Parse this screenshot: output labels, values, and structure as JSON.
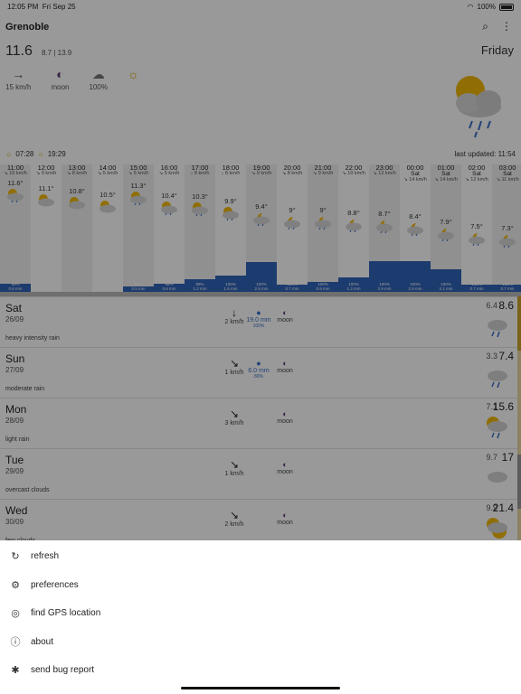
{
  "status_bar": {
    "time": "12:05 PM",
    "date": "Fri Sep 25",
    "battery": "100%"
  },
  "header": {
    "location": "Grenoble",
    "day": "Friday",
    "search_icon": "search-icon",
    "more_icon": "more-vert-icon"
  },
  "current": {
    "temp": "11.6",
    "temp_min": "8.7",
    "temp_sep": "|",
    "temp_max": "13.9",
    "wind_arrow": "→",
    "wind": "15 km/h",
    "moon": "moon",
    "clouds": "100%"
  },
  "sun": {
    "rise": "07:28",
    "set": "19:29"
  },
  "last_updated": "last updated: 11:54",
  "hourly": [
    {
      "time": "11:00",
      "wind": "↘ 15 km/h",
      "temp": "11.6°",
      "rain_pct": "99%",
      "rain_mm": "0.6 mm",
      "rain_level": 0.22
    },
    {
      "time": "12:00",
      "wind": "↘ 9 km/h",
      "temp": "11.1°",
      "rain_pct": "",
      "rain_mm": "",
      "rain_level": 0
    },
    {
      "time": "13:00",
      "wind": "↘ 8 km/h",
      "temp": "10.8°",
      "rain_pct": "",
      "rain_mm": "",
      "rain_level": 0
    },
    {
      "time": "14:00",
      "wind": "↘ 5 km/h",
      "temp": "10.5°",
      "rain_pct": "",
      "rain_mm": "",
      "rain_level": 0
    },
    {
      "time": "15:00",
      "wind": "↘ 5 km/h",
      "temp": "11.3°",
      "rain_pct": "99%",
      "rain_mm": "0.5 mm",
      "rain_level": 0.14
    },
    {
      "time": "16:00",
      "wind": "↘ 5 km/h",
      "temp": "10.4°",
      "rain_pct": "98%",
      "rain_mm": "0.8 mm",
      "rain_level": 0.22
    },
    {
      "time": "17:00",
      "wind": "↓ 8 km/h",
      "temp": "10.3°",
      "rain_pct": "99%",
      "rain_mm": "1.2 mm",
      "rain_level": 0.33
    },
    {
      "time": "18:00",
      "wind": "↓ 8 km/h",
      "temp": "9.9°",
      "rain_pct": "100%",
      "rain_mm": "1.6 mm",
      "rain_level": 0.44
    },
    {
      "time": "19:00",
      "wind": "↘ 9 km/h",
      "temp": "9.4°",
      "rain_pct": "100%",
      "rain_mm": "2.8 mm",
      "rain_level": 0.78
    },
    {
      "time": "20:00",
      "wind": "↘ 8 km/h",
      "temp": "9°",
      "rain_pct": "100%",
      "rain_mm": "0.7 mm",
      "rain_level": 0.2
    },
    {
      "time": "21:00",
      "wind": "↘ 9 km/h",
      "temp": "9°",
      "rain_pct": "100%",
      "rain_mm": "0.9 mm",
      "rain_level": 0.26
    },
    {
      "time": "22:00",
      "wind": "↘ 10 km/h",
      "temp": "8.8°",
      "rain_pct": "100%",
      "rain_mm": "1.3 mm",
      "rain_level": 0.38
    },
    {
      "time": "23:00",
      "wind": "↘ 12 km/h",
      "temp": "8.7°",
      "rain_pct": "100%",
      "rain_mm": "2.9 mm",
      "rain_level": 0.8
    },
    {
      "time": "00:00",
      "day": "Sat",
      "wind": "↘ 14 km/h",
      "temp": "8.4°",
      "rain_pct": "100%",
      "rain_mm": "2.9 mm",
      "rain_level": 0.8
    },
    {
      "time": "01:00",
      "day": "Sat",
      "wind": "↘ 14 km/h",
      "temp": "7.9°",
      "rain_pct": "100%",
      "rain_mm": "2.1 mm",
      "rain_level": 0.6
    },
    {
      "time": "02:00",
      "day": "Sat",
      "wind": "↘ 12 km/h",
      "temp": "7.5°",
      "rain_pct": "100%",
      "rain_mm": "0.7 mm",
      "rain_level": 0.2
    },
    {
      "time": "03:00",
      "day": "Sat",
      "wind": "↘ 11 km/h",
      "temp": "7.3°",
      "rain_pct": "100%",
      "rain_mm": "0.7 mm",
      "rain_level": 0.2
    }
  ],
  "daily": [
    {
      "day": "Sat",
      "date": "26/09",
      "desc": "heavy intensity rain",
      "wind_arrow": "↓",
      "wind": "2 km/h",
      "rain": "19.0 mm",
      "rain_pct": "100%",
      "moon": "moon",
      "min": "6.4",
      "max": "8.6",
      "icon": "rain"
    },
    {
      "day": "Sun",
      "date": "27/09",
      "desc": "moderate rain",
      "wind_arrow": "↘",
      "wind": "1 km/h",
      "rain": "6.0 mm",
      "rain_pct": "80%",
      "moon": "moon",
      "min": "3.3",
      "max": "7.4",
      "icon": "rain"
    },
    {
      "day": "Mon",
      "date": "28/09",
      "desc": "light rain",
      "wind_arrow": "↘",
      "wind": "3 km/h",
      "rain": "",
      "rain_pct": "",
      "moon": "moon",
      "min": "7.1",
      "max": "15.6",
      "icon": "rain-sun"
    },
    {
      "day": "Tue",
      "date": "29/09",
      "desc": "overcast clouds",
      "wind_arrow": "↘",
      "wind": "1 km/h",
      "rain": "",
      "rain_pct": "",
      "moon": "moon",
      "min": "9.7",
      "max": "17",
      "icon": "cloud"
    },
    {
      "day": "Wed",
      "date": "30/09",
      "desc": "few clouds",
      "wind_arrow": "↘",
      "wind": "2 km/h",
      "rain": "",
      "rain_pct": "",
      "moon": "moon",
      "min": "9.9",
      "max": "21.4",
      "icon": "sun-cloud"
    }
  ],
  "menu": [
    {
      "label": "refresh",
      "icon": "refresh-icon",
      "glyph": "↻"
    },
    {
      "label": "preferences",
      "icon": "settings-icon",
      "glyph": "⚙"
    },
    {
      "label": "find GPS location",
      "icon": "gps-icon",
      "glyph": "◎"
    },
    {
      "label": "about",
      "icon": "info-icon",
      "glyph": "ⓘ"
    },
    {
      "label": "send bug report",
      "icon": "bug-icon",
      "glyph": "✱"
    }
  ],
  "colors": {
    "rain_blue": "#2f63b8",
    "sun_yellow": "#f2b705",
    "cloud_grey": "#c9c9c9",
    "moon_purple": "#5b3a70",
    "drop_blue": "#3a6fc6"
  }
}
